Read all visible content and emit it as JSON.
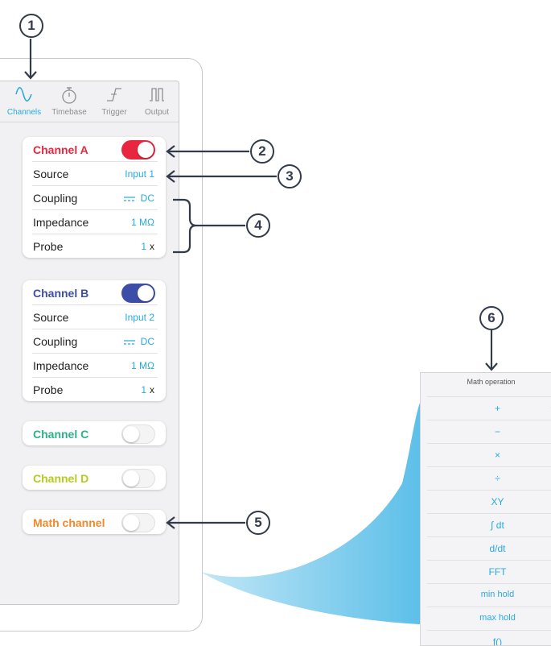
{
  "callouts": [
    "1",
    "2",
    "3",
    "4",
    "5",
    "6"
  ],
  "tabs": [
    {
      "label": "Channels",
      "icon": "sine-wave-icon",
      "active": true
    },
    {
      "label": "Timebase",
      "icon": "stopwatch-icon",
      "active": false
    },
    {
      "label": "Trigger",
      "icon": "trigger-edge-icon",
      "active": false
    },
    {
      "label": "Output",
      "icon": "square-wave-icon",
      "active": false
    }
  ],
  "channel_a": {
    "title": "Channel A",
    "color": "#e8263f",
    "enabled": true,
    "source_label": "Source",
    "source_value": "Input 1",
    "coupling_label": "Coupling",
    "coupling_value": "DC",
    "impedance_label": "Impedance",
    "impedance_value": "1 MΩ",
    "probe_label": "Probe",
    "probe_value": "1",
    "probe_unit": "x"
  },
  "channel_b": {
    "title": "Channel B",
    "color": "#3d4ea8",
    "enabled": true,
    "source_label": "Source",
    "source_value": "Input 2",
    "coupling_label": "Coupling",
    "coupling_value": "DC",
    "impedance_label": "Impedance",
    "impedance_value": "1 MΩ",
    "probe_label": "Probe",
    "probe_value": "1",
    "probe_unit": "x"
  },
  "channel_c": {
    "title": "Channel C",
    "color": "#2bb28a",
    "enabled": false
  },
  "channel_d": {
    "title": "Channel D",
    "color": "#b5cc1c",
    "enabled": false
  },
  "math_channel": {
    "title": "Math channel",
    "color": "#f0892a",
    "enabled": false
  },
  "math_panel": {
    "title": "Math operation",
    "options": [
      "+",
      "−",
      "×",
      "÷",
      "XY",
      "∫ dt",
      "d/dt",
      "FFT",
      "min hold",
      "max hold",
      "f()"
    ],
    "selected": "+"
  },
  "accent": "#27aae1"
}
